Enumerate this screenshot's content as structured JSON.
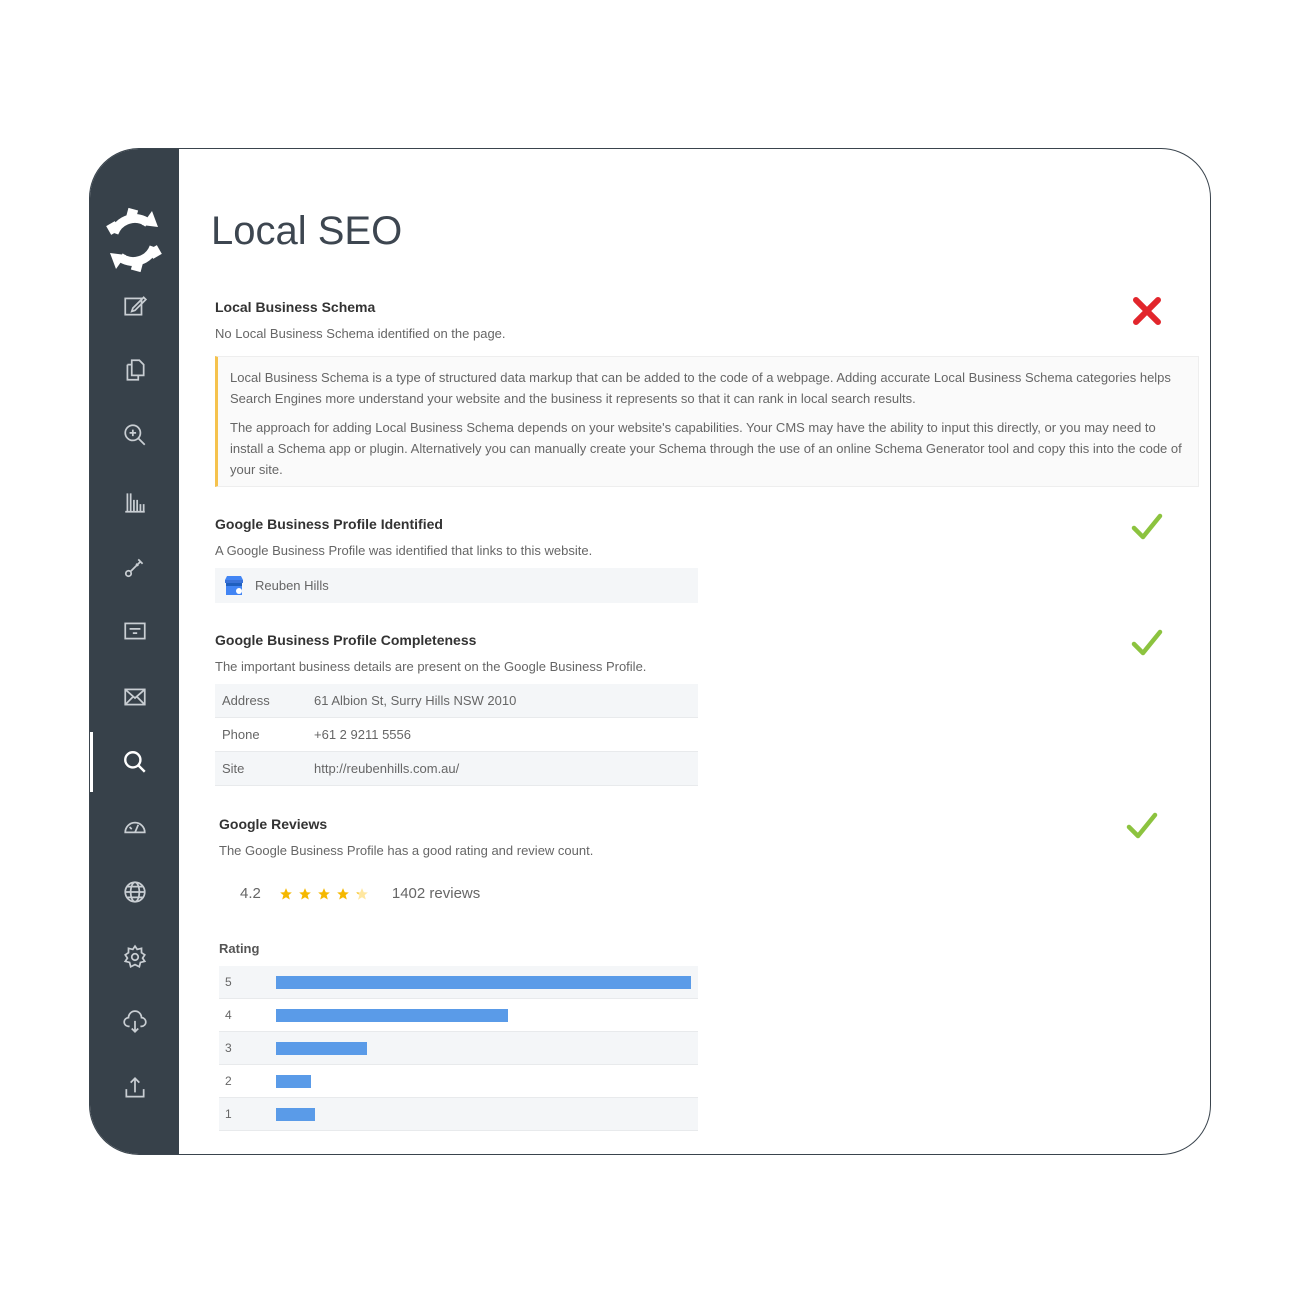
{
  "page": {
    "title": "Local SEO"
  },
  "sections": {
    "schema": {
      "title": "Local Business Schema",
      "description": "No Local Business Schema identified on the page.",
      "status": "fail",
      "info_paragraphs": [
        "Local Business Schema is a type of structured data markup that can be added to the code of a webpage. Adding accurate Local Business Schema categories helps Search Engines more understand your website and the business it represents so that it can rank in local search results.",
        "The approach for adding Local Business Schema depends on your website's capabilities. Your CMS may have the ability to input this directly, or you may need to install a Schema app or plugin. Alternatively you can manually create your Schema through the use of an online Schema Generator tool and copy this into the code of your site."
      ]
    },
    "gbp": {
      "title": "Google Business Profile Identified",
      "description": "A Google Business Profile was identified that links to this website.",
      "status": "pass",
      "business_name": "Reuben Hills"
    },
    "completeness": {
      "title": "Google Business Profile Completeness",
      "description": "The important business details are present on the Google Business Profile.",
      "status": "pass",
      "rows": [
        {
          "key": "Address",
          "value": "61 Albion St, Surry Hills NSW 2010"
        },
        {
          "key": "Phone",
          "value": "+61 2 9211 5556"
        },
        {
          "key": "Site",
          "value": "http://reubenhills.com.au/"
        }
      ]
    },
    "reviews": {
      "title": "Google Reviews",
      "description": "The Google Business Profile has a good rating and review count.",
      "status": "pass",
      "rating": "4.2",
      "review_count": "1402 reviews",
      "stars_value": 4.2,
      "rating_label": "Rating",
      "distribution": [
        {
          "stars": "5",
          "fraction": 1.0
        },
        {
          "stars": "4",
          "fraction": 0.56
        },
        {
          "stars": "3",
          "fraction": 0.22
        },
        {
          "stars": "2",
          "fraction": 0.085
        },
        {
          "stars": "1",
          "fraction": 0.095
        }
      ]
    }
  },
  "colors": {
    "sidebar": "#37414a",
    "fail": "#e2262c",
    "pass": "#8cc33f",
    "star": "#f5b800",
    "bar": "#5a9be8",
    "info_border": "#f5c24d"
  },
  "nav": [
    {
      "name": "edit-icon"
    },
    {
      "name": "pages-icon"
    },
    {
      "name": "zoom-in-icon"
    },
    {
      "name": "bar-chart-icon"
    },
    {
      "name": "link-icon"
    },
    {
      "name": "content-icon"
    },
    {
      "name": "mail-icon"
    },
    {
      "name": "search-icon",
      "active": true
    },
    {
      "name": "speed-icon"
    },
    {
      "name": "globe-icon"
    },
    {
      "name": "settings-icon"
    },
    {
      "name": "cloud-download-icon"
    },
    {
      "name": "upload-icon"
    }
  ]
}
